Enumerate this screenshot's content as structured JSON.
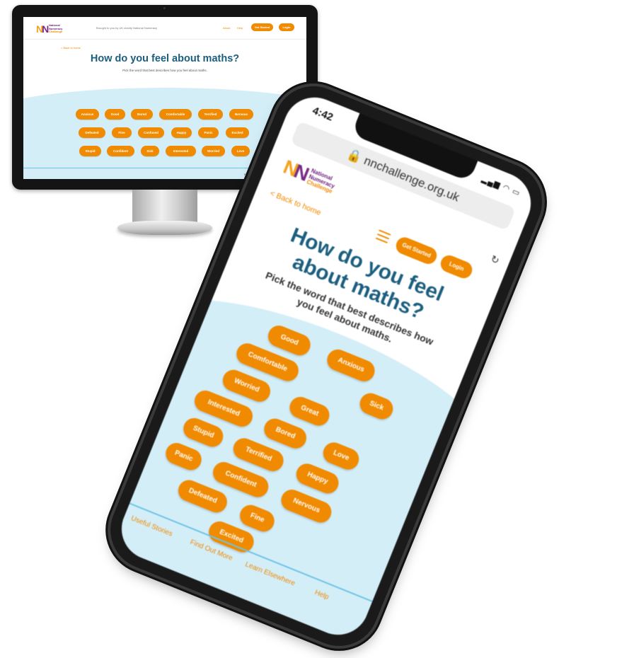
{
  "desktop": {
    "logo": {
      "line1": "National",
      "line2": "Numeracy",
      "line3": "Challenge"
    },
    "tagline": "Brought to you by UK charity National Numeracy",
    "nav": {
      "about": "About",
      "help": "Help",
      "get_started": "Get Started",
      "login": "Login"
    },
    "back_link": "< Back to home",
    "title": "How do you feel about maths?",
    "subtitle": "Pick the word that best describes how you feel about maths.",
    "words": [
      "Anxious",
      "Good",
      "Bored",
      "Comfortable",
      "Terrified",
      "Nervous",
      "Defeated",
      "Fine",
      "Confused",
      "Happy",
      "Panic",
      "Excited",
      "Stupid",
      "Confident",
      "Sick",
      "Interested",
      "Worried",
      "Love"
    ],
    "footer": "Follow us on"
  },
  "phone": {
    "time": "4:42",
    "status": "▂▄▆ ◠ ▭",
    "url": "🔒 nnchallenge.org.uk",
    "refresh_icon": "↻",
    "logo": {
      "line1": "National",
      "line2": "Numeracy",
      "line3": "Challenge"
    },
    "back_link": "< Back to home",
    "get_started": "Get Started",
    "login": "Login",
    "title_line1": "How do you feel",
    "title_line2": "about maths?",
    "subtitle_line1": "Pick the word that best describes how",
    "subtitle_line2": "you feel about maths.",
    "words": [
      "Good",
      "Anxious",
      "Comfortable",
      "Sick",
      "Worried",
      "Great",
      "Interested",
      "Bored",
      "Love",
      "Terrified",
      "Happy",
      "Stupid",
      "Confident",
      "Nervous",
      "Panic",
      "Defeated",
      "Fine",
      "Excited"
    ],
    "footer_links": [
      "Useful Stories",
      "Find Out More",
      "Learn Elsewhere",
      "Help"
    ]
  },
  "colors": {
    "orange": "#f08a00",
    "title_blue": "#1b5e7e",
    "light_blue": "#d4eef8",
    "purple": "#7a2a86"
  }
}
